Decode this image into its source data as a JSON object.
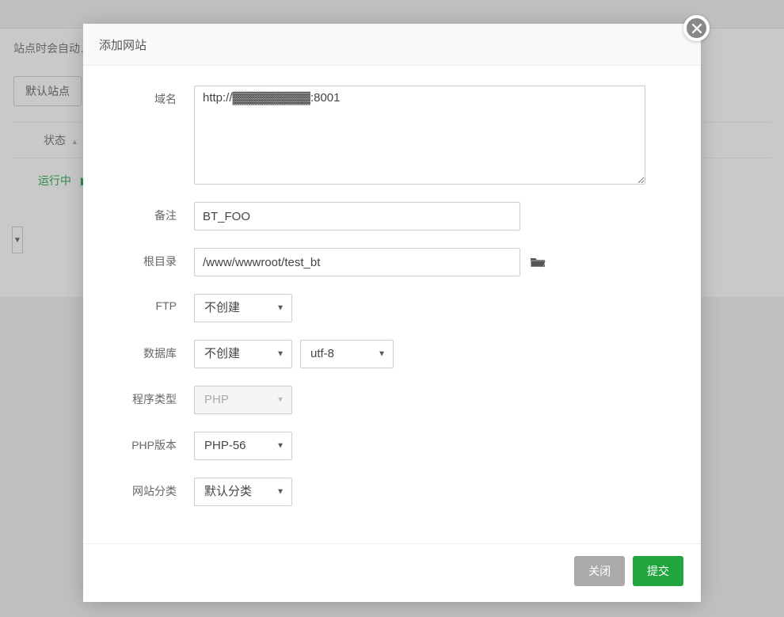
{
  "background": {
    "hint_partial": "站点时会自动…",
    "default_site_btn": "默认站点",
    "status_header": "状态",
    "status_running": "运行中"
  },
  "modal": {
    "title": "添加网站",
    "labels": {
      "domain": "域名",
      "remark": "备注",
      "root_dir": "根目录",
      "ftp": "FTP",
      "database": "数据库",
      "program_type": "程序类型",
      "php_version": "PHP版本",
      "site_category": "网站分类"
    },
    "values": {
      "domain": "http://▓▓▓▓▓▓▓▓▓:8001",
      "remark": "BT_FOO",
      "root_dir": "/www/wwwroot/test_bt",
      "ftp": "不创建",
      "database": "不创建",
      "charset": "utf-8",
      "program_type": "PHP",
      "php_version": "PHP-56",
      "site_category": "默认分类"
    },
    "buttons": {
      "close": "关闭",
      "submit": "提交"
    }
  }
}
